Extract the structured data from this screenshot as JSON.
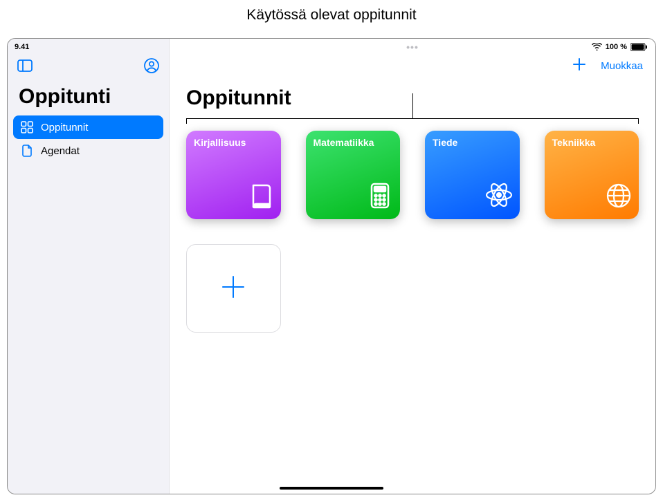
{
  "annotation": "Käytössä olevat oppitunnit",
  "status": {
    "time": "9.41",
    "battery_text": "100 %"
  },
  "sidebar": {
    "title": "Oppitunti",
    "items": [
      {
        "label": "Oppitunnit",
        "icon": "grid-icon",
        "active": true
      },
      {
        "label": "Agendat",
        "icon": "document-icon",
        "active": false
      }
    ]
  },
  "main": {
    "title": "Oppitunnit",
    "edit_label": "Muokkaa"
  },
  "lessons": [
    {
      "title": "Kirjallisuus",
      "icon": "book-icon",
      "color_class": "card-literature"
    },
    {
      "title": "Matematiikka",
      "icon": "calculator-icon",
      "color_class": "card-math"
    },
    {
      "title": "Tiede",
      "icon": "atom-icon",
      "color_class": "card-science"
    },
    {
      "title": "Tekniikka",
      "icon": "globe-icon",
      "color_class": "card-tech"
    }
  ]
}
